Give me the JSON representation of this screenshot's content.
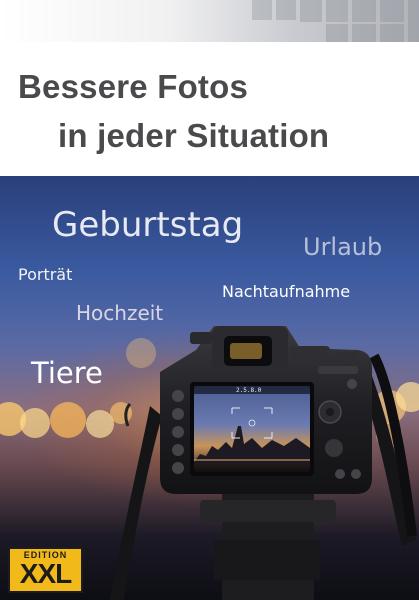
{
  "title": {
    "line1": "Bessere Fotos",
    "line2": "in jeder Situation"
  },
  "keywords": {
    "geburtstag": "Geburtstag",
    "urlaub": "Urlaub",
    "portraet": "Porträt",
    "nachtaufnahme": "Nachtaufnahme",
    "hochzeit": "Hochzeit",
    "tiere": "Tiere"
  },
  "camera": {
    "screen_readout": "2.5.8.0"
  },
  "logo": {
    "edition": "EDITION",
    "brand": "XXL"
  },
  "colors": {
    "title_text": "#4a4a4d",
    "logo_yellow": "#f2b91a",
    "sky_blue": "#3a5aa0"
  },
  "icons": [
    "dslr-camera-illustration"
  ]
}
